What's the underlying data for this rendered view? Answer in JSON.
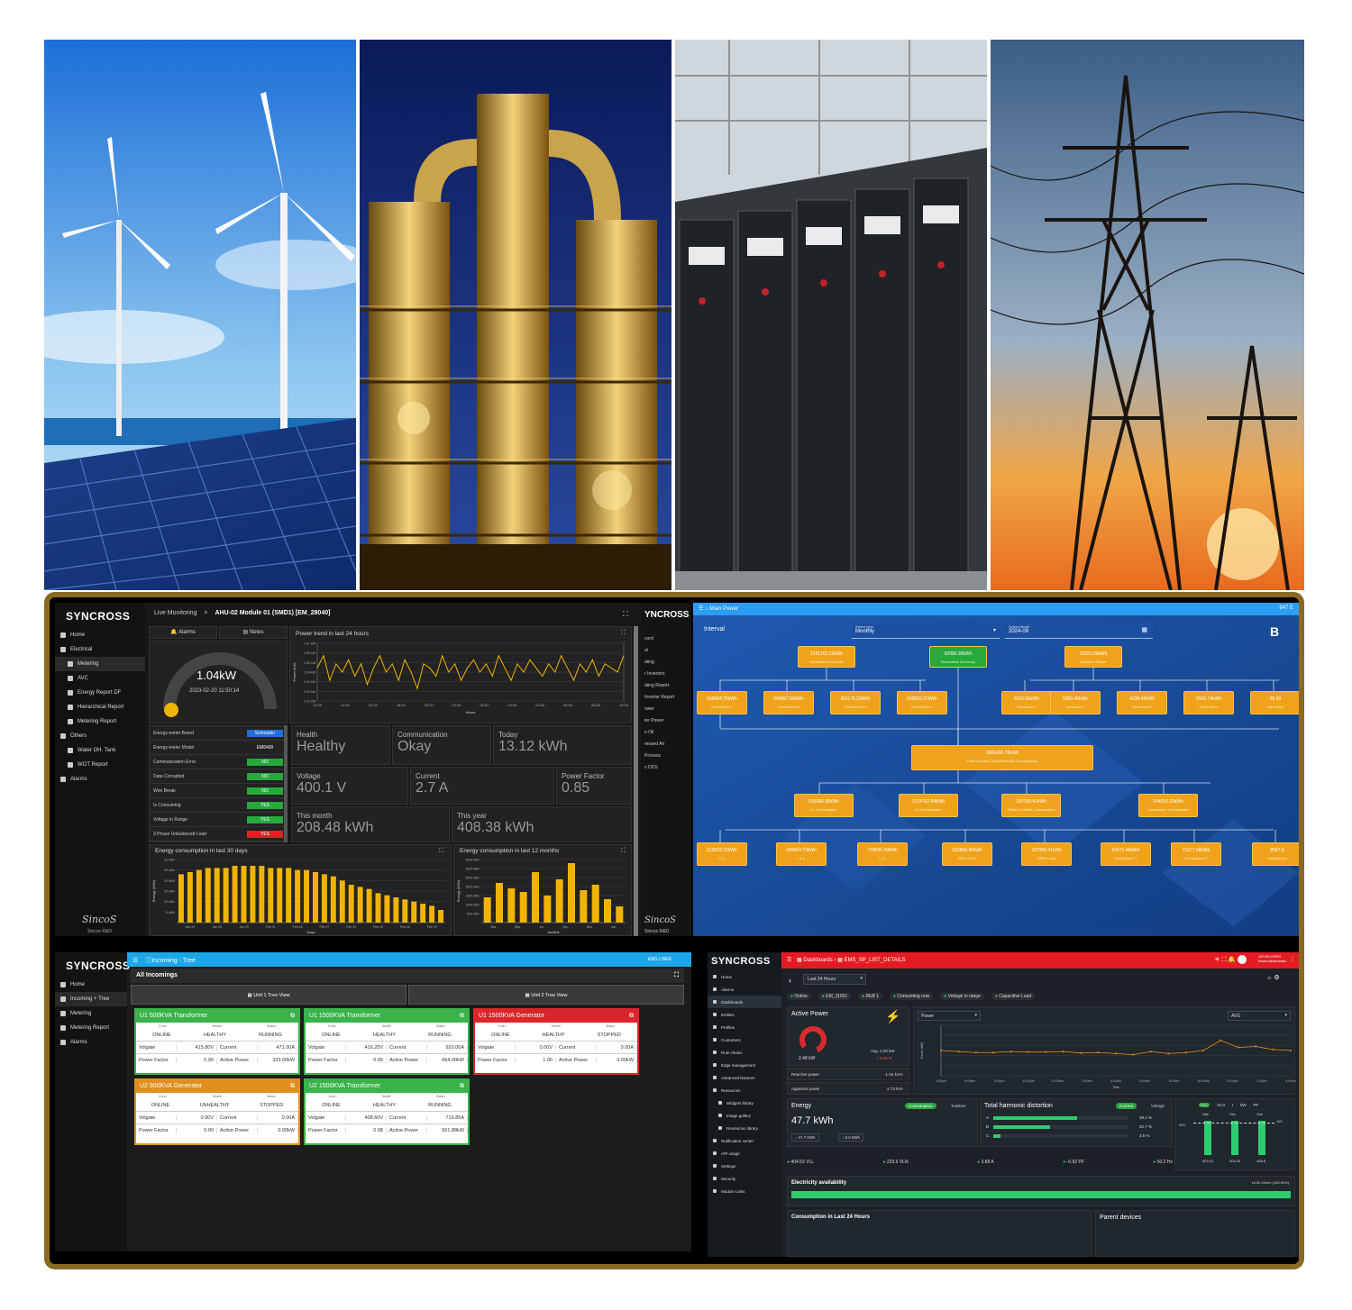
{
  "hero": {
    "panels": [
      "wind-and-solar",
      "refinery-at-night",
      "switchgear-room",
      "transmission-towers"
    ]
  },
  "q1": {
    "logo": "SYNCROSS",
    "breadcrumb_root": "Live Monitoring",
    "breadcrumb_sep": ">",
    "breadcrumb_page": "AHU-02 Module 01 (SMD1) [EM_28040]",
    "sidebar": [
      {
        "label": "Home",
        "icon": "home-icon"
      },
      {
        "label": "Electrical",
        "icon": "bolt-icon"
      },
      {
        "label": "Metering",
        "icon": "grid-icon"
      },
      {
        "label": "AVC",
        "icon": "grid-icon"
      },
      {
        "label": "Energy Report DF",
        "icon": "grid-icon"
      },
      {
        "label": "Hierarchical Report",
        "icon": "circle-icon"
      },
      {
        "label": "Metering Report",
        "icon": "circle-icon"
      },
      {
        "label": "Others",
        "icon": "grid-icon"
      },
      {
        "label": "Water OH. Tank",
        "icon": "grid-icon"
      },
      {
        "label": "WOT Report",
        "icon": "grid-icon"
      },
      {
        "label": "Alarms",
        "icon": "bell-icon"
      }
    ],
    "alarms": "Alarms",
    "notes": "Notes",
    "gauge_value": "1.04kW",
    "gauge_time": "2023-02-20 11:50:14",
    "trend_title": "Power trend in last 24 hours",
    "trend_ylabel": "Power (kW)",
    "trend_xlabel": "Hours",
    "trend_y": [
      "1.07 kW",
      "1.06 kW",
      "1.05 kW",
      "1.04 kW",
      "1.03 kW",
      "1.02 kW",
      "1.01 kW"
    ],
    "trend_x": [
      "12:00",
      "14:00",
      "16:00",
      "18:00",
      "20:00",
      "22:00",
      "00:00",
      "02:00",
      "04:00",
      "06:00",
      "08:00",
      "10:00"
    ],
    "info": [
      {
        "k": "Energy-meter Brand",
        "v": "Schneider",
        "c": "#1e6fd9"
      },
      {
        "k": "Energy-meter Model",
        "v": "EM6400",
        "c": ""
      },
      {
        "k": "Communication Error",
        "v": "NO",
        "c": "#27a93c"
      },
      {
        "k": "Data Corrupted",
        "v": "NO",
        "c": "#27a93c"
      },
      {
        "k": "Wire Break",
        "v": "NO",
        "c": "#27a93c"
      },
      {
        "k": "Is Consuming",
        "v": "YES",
        "c": "#27a93c"
      },
      {
        "k": "Voltage in Range",
        "v": "YES",
        "c": "#27a93c"
      },
      {
        "k": "3 Phase Unbalanced Load",
        "v": "YES",
        "c": "#d22"
      }
    ],
    "health_l": "Health",
    "health_v": "Healthy",
    "comm_l": "Communication",
    "comm_v": "Okay",
    "today_l": "Today",
    "today_v": "13.12 kWh",
    "volt_l": "Voltage",
    "volt_v": "400.1 V",
    "curr_l": "Current",
    "curr_v": "2.7 A",
    "pf_l": "Power Factor",
    "pf_v": "0.85",
    "month_l": "This month",
    "month_v": "208.48 kWh",
    "year_l": "This year",
    "year_v": "408.38 kWh",
    "e30_title": "Energy consumption in last 30 days",
    "e30_ylabel": "Energy (kWh)",
    "e30_xlabel": "Days",
    "e30_y": [
      "30 kWh",
      "25 kWh",
      "20 kWh",
      "15 kWh",
      "10 kWh",
      "5 kWh"
    ],
    "e30_x": [
      "Jan 23",
      "Jan 26",
      "Jan 29",
      "Feb 01",
      "Feb 04",
      "Feb 07",
      "Feb 10",
      "Feb 13",
      "Feb 16",
      "Feb 19"
    ],
    "e12_title": "Energy consumption in last 12 months",
    "e12_ylabel": "Energy (kWh)",
    "e12_xlabel": "Months",
    "e12_y": [
      "3500 kWh",
      "3000 kWh",
      "2500 kWh",
      "2000 kWh",
      "1500 kWh",
      "1000 kWh",
      "500 kWh"
    ],
    "e12_x": [
      "Mar",
      "May",
      "Jul",
      "Sep",
      "Nov",
      "Jan"
    ],
    "footer_logo": "SincoS",
    "footer_text": "Sincos R&D",
    "strip_logo": "YNCROSS",
    "strip_items": [
      "cord",
      "al",
      "ating",
      "r Inverters",
      "ating Report",
      "Inverter Report",
      "ower",
      "ter Power",
      "n Oil",
      "ressed Air",
      "Process",
      "n DDS"
    ],
    "strip_footer": "SincoS",
    "strip_footer_text": "Sincos R&D"
  },
  "q2": {
    "title": "Main Power",
    "interval": "Interval",
    "select_type_label": "Select type",
    "select_type": "Monthly",
    "select_month_label": "Select Month",
    "select_month": "2024-09",
    "corner": "847 E",
    "brand": "B",
    "top": [
      {
        "v": "2181162.11kWh",
        "s": "Purchased Electricity",
        "c": "#f0a31a"
      },
      {
        "v": "92900.30kWh",
        "s": "Renewable Electricity",
        "c": "#27a93c"
      },
      {
        "v": "23923.05kWh",
        "s": "Standard Power",
        "c": "#f0a31a"
      }
    ],
    "row2": [
      {
        "v": "539084.75kWh",
        "s": "Transformer 1"
      },
      {
        "v": "246897.65kWh",
        "s": "Transformer 2"
      },
      {
        "v": "361178.29kWh",
        "s": "Transformer 3"
      },
      {
        "v": "508932.27kWh",
        "s": "Transformer 4"
      },
      {
        "v": "6115.56kWh",
        "s": "Generator 1"
      },
      {
        "v": "5089.46kWh",
        "s": "Generator 2"
      },
      {
        "v": "4038.44kWh",
        "s": "Generator 3"
      },
      {
        "v": "5553.74kWh",
        "s": "Generator 4"
      },
      {
        "v": "25.49",
        "s": "Generator"
      }
    ],
    "main": {
      "v": "2806438.78kWh",
      "s": "Main Bus Bar (Total Electricity Consumption)"
    },
    "row4": [
      {
        "v": "616686.96kWh",
        "s": "L1 Consumption"
      },
      {
        "v": "1124702.94kWh",
        "s": "L2 Consumption"
      },
      {
        "v": "187099.41kWh",
        "s": "Office & Utilities Consumption"
      },
      {
        "v": "144816.20kWh",
        "s": "Compressor Consumption"
      }
    ],
    "row5": [
      {
        "v": "219022.23kWh",
        "s": "L1.1"
      },
      {
        "v": "400664.73kWh",
        "s": "L1.2"
      },
      {
        "v": "729545.49kWh",
        "s": "L2.1"
      },
      {
        "v": "392858.46kWh",
        "s": "DSP Line 2"
      },
      {
        "v": "187099.41kWh",
        "s": "Office Load"
      },
      {
        "v": "64271.48kWh",
        "s": "Compressor 1"
      },
      {
        "v": "71977.98kWh",
        "s": "Compressor 2"
      },
      {
        "v": "8567.8",
        "s": "Compressor"
      }
    ]
  },
  "q3": {
    "logo": "SYNCROSS",
    "title": "Incoming - Tree",
    "user": "EMS USER",
    "sidebar": [
      "Home",
      "Incoming + Tree",
      "Metering",
      "Metering Report",
      "Alarms"
    ],
    "all": "All Incomings",
    "tab1": "Unit 1 Tree View",
    "tab2": "Unit 2 Tree View",
    "heads": {
      "comm": "Conn.",
      "health": "Health",
      "status": "Status"
    },
    "keys": {
      "v": "Volgate",
      "c": "Current",
      "pf": "Power Factor",
      "ap": "Active Power"
    },
    "cards": [
      {
        "name": "U1 500KVA Transformer",
        "comm": "ONLINE",
        "health": "HEALTHY",
        "status": "RUNNING",
        "v": "415.80V",
        "c": "471.00A",
        "pf": "0.99",
        "ap": "333.00kW",
        "cls": ""
      },
      {
        "name": "U1 1500KVA Transformer",
        "comm": "ONLINE",
        "health": "HEALTHY",
        "status": "RUNNING",
        "v": "416.20V",
        "c": "920.00A",
        "pf": "0.99",
        "ap": "664.00kW",
        "cls": ""
      },
      {
        "name": "U1 1500KVA Generator",
        "comm": "ONLINE",
        "health": "HEALTHY",
        "status": "STOPPED",
        "v": "0.00V",
        "c": "0.00A",
        "pf": "1.00",
        "ap": "0.00kW",
        "cls": "red"
      },
      {
        "name": "U2 900KVA Generator",
        "comm": "ONLINE",
        "health": "UNHEALTHY",
        "status": "STOPPED",
        "v": "0.00V",
        "c": "0.00A",
        "pf": "0.00",
        "ap": "0.00kW",
        "cls": "org"
      },
      {
        "name": "U2 1500KVA Transformer",
        "comm": "ONLINE",
        "health": "HEALTHY",
        "status": "RUNNING",
        "v": "408.60V",
        "c": "719.85A",
        "pf": "0.98",
        "ap": "501.88kW",
        "cls": ""
      }
    ]
  },
  "q4": {
    "logo": "SYNCROSS",
    "crumb1": "Dashboards",
    "crumb2": "EMS_SP_LIST_DETAILS",
    "user": "DEVELOPER",
    "user_sub": "tenant administrator",
    "sidebar": [
      "Home",
      "Alarms",
      "Dashboards",
      "Entities",
      "Profiles",
      "Customers",
      "Rule chains",
      "Edge management",
      "Advanced features",
      "Resources",
      "Widgets library",
      "Image gallery",
      "Resources library",
      "Notification center",
      "API usage",
      "Settings",
      "Security",
      "Module Links"
    ],
    "range": "Last 24 Hours",
    "chips": [
      "Online",
      "EM_11001",
      "REB 1",
      "Consuming now",
      "Voltage in range",
      "Capacitive Load"
    ],
    "ap_title": "Active Power",
    "ap_value": "2.48 kW",
    "ap_avg": "Avg. 2.00 kW",
    "ap_delta": "+ 2.08 %",
    "rp_l": "Reactive power",
    "rp_v": "-1.04 kVAr",
    "app_l": "Apparent power",
    "app_v": "2.73 kVA",
    "sel_power": "Power",
    "sel_avg": "AVG",
    "chart_ylabel": "Power (kW)",
    "chart_xlabel": "Time",
    "chart_x": [
      "4:00pm",
      "6:00pm",
      "8:00pm",
      "10:00pm",
      "12:00am",
      "2:00am",
      "4:00am",
      "6:00am",
      "8:00am",
      "10:00am",
      "12:00pm",
      "2:00pm",
      "4:00pm"
    ],
    "en_title": "Energy",
    "en_btn1": "Consumption",
    "en_btn2": "Totalizer",
    "en_value": "47.7 kWh",
    "en_in": "47.7 kWh",
    "en_out": "0.0 kWh",
    "thd_title": "Total harmonic distortion",
    "thd_btn1": "Current",
    "thd_btn2": "Voltage",
    "thd": [
      {
        "p": "A",
        "v": "39.4 %",
        "f": 0.62
      },
      {
        "p": "B",
        "v": "32.7 %",
        "f": 0.42
      },
      {
        "p": "C",
        "v": "3.5 %",
        "f": 0.05
      }
    ],
    "vbars_tabs": [
      "VLL",
      "VLN",
      "I",
      "kW",
      "PF"
    ],
    "vbars_heads": [
      "Vab",
      "Vbc",
      "Vca"
    ],
    "vbars_vals": [
      "403.41",
      "404.20",
      "405.8"
    ],
    "vbars_lo": "300",
    "vbars_hi": "420",
    "readouts": [
      "404.53 VLL",
      "233.6 VLN",
      "3.88 A",
      "-0.92 PF",
      "50.2 Hz"
    ],
    "avail_title": "Electricity availability",
    "avail_note": "1d 0h 22min (100.00%)",
    "bottom1": "Consumption in Last 24 Hours",
    "bottom2": "Parent devices"
  },
  "chart_data": [
    {
      "type": "line",
      "title": "Power trend in last 24 hours",
      "xlabel": "Hours",
      "ylabel": "Power (kW)",
      "ylim": [
        1.005,
        1.075
      ],
      "x": [
        "12:00",
        "14:00",
        "16:00",
        "18:00",
        "20:00",
        "22:00",
        "00:00",
        "02:00",
        "04:00",
        "06:00",
        "08:00",
        "10:00"
      ],
      "series": [
        {
          "values": [
            1.045,
            1.06,
            1.03,
            1.05,
            1.04,
            1.055,
            1.035,
            1.05,
            1.025,
            1.045,
            1.06,
            1.04,
            1.05,
            1.03,
            1.055,
            1.04,
            1.02,
            1.05,
            1.045,
            1.035,
            1.06,
            1.04,
            1.05,
            1.03,
            1.045,
            1.055,
            1.04,
            1.05,
            1.035,
            1.06,
            1.045,
            1.03,
            1.05,
            1.04,
            1.055,
            1.045,
            1.035,
            1.05,
            1.04,
            1.06,
            1.045,
            1.03,
            1.05,
            1.04,
            1.055,
            1.035,
            1.05,
            1.045,
            1.04,
            1.06
          ]
        }
      ]
    },
    {
      "type": "bar",
      "title": "Energy consumption in last 30 days",
      "xlabel": "Days",
      "ylabel": "Energy (kWh)",
      "ylim": [
        0,
        30
      ],
      "categories": [
        "Jan 22",
        "Jan 23",
        "Jan 24",
        "Jan 25",
        "Jan 26",
        "Jan 27",
        "Jan 28",
        "Jan 29",
        "Jan 30",
        "Jan 31",
        "Feb 01",
        "Feb 02",
        "Feb 03",
        "Feb 04",
        "Feb 05",
        "Feb 06",
        "Feb 07",
        "Feb 08",
        "Feb 09",
        "Feb 10",
        "Feb 11",
        "Feb 12",
        "Feb 13",
        "Feb 14",
        "Feb 15",
        "Feb 16",
        "Feb 17",
        "Feb 18",
        "Feb 19",
        "Feb 20"
      ],
      "values": [
        23,
        24,
        25,
        26,
        26,
        26,
        27,
        27,
        27,
        27,
        26,
        26,
        26,
        25,
        25,
        24,
        23,
        22,
        20,
        18,
        17,
        16,
        14,
        13,
        12,
        11,
        10,
        9,
        8,
        6
      ]
    },
    {
      "type": "bar",
      "title": "Energy consumption in last 12 months",
      "xlabel": "Months",
      "ylabel": "Energy (kWh)",
      "ylim": [
        0,
        3500
      ],
      "categories": [
        "Mar",
        "Apr",
        "May",
        "Jun",
        "Jul",
        "Aug",
        "Sep",
        "Oct",
        "Nov",
        "Dec",
        "Jan",
        "Feb"
      ],
      "values": [
        1400,
        2200,
        1900,
        1700,
        2800,
        1500,
        2400,
        3300,
        1800,
        2100,
        1300,
        900
      ]
    },
    {
      "type": "line",
      "ylabel": "Power (kW)",
      "xlabel": "Time",
      "ylim": [
        0,
        5
      ],
      "x": [
        "4:00pm",
        "6:00pm",
        "8:00pm",
        "10:00pm",
        "12:00am",
        "2:00am",
        "4:00am",
        "6:00am",
        "8:00am",
        "10:00am",
        "12:00pm",
        "2:00pm",
        "4:00pm"
      ],
      "series": [
        {
          "values": [
            2.5,
            2.4,
            2.3,
            2.3,
            2.4,
            2.35,
            2.35,
            2.4,
            2.25,
            2.3,
            2.2,
            2.1,
            2.4,
            2.2,
            2.3,
            2.5,
            3.5,
            2.8,
            2.9,
            2.6,
            2.5
          ]
        }
      ]
    }
  ]
}
